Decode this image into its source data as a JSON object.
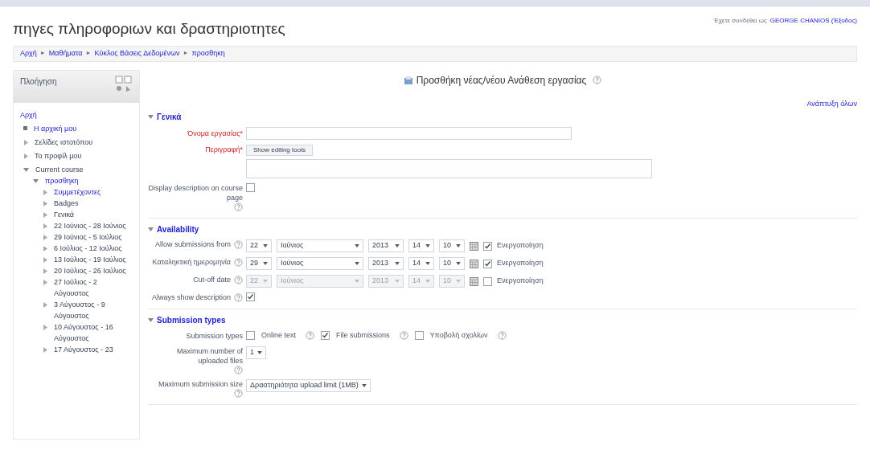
{
  "header": {
    "title": "πηγες πληροφοριων και δραστηριοτητες",
    "login_text": "Έχετε συνδεθεί ως",
    "login_link": "GEORGE CHANIOS (Έξοδος)"
  },
  "breadcrumb": [
    "Αρχή",
    "Μαθήματα",
    "Κύκλος Βάσεις Δεδομένων",
    "προσθηκη"
  ],
  "breadcrumb_separator": "►",
  "sidebar": {
    "title": "Πλοήγηση",
    "items": [
      {
        "label": "Αρχή",
        "kind": "root",
        "link": true
      },
      {
        "label": "Η αρχική μου",
        "kind": "leaf",
        "link": true
      },
      {
        "label": "Σελίδες ιστοτόπου",
        "kind": "branch",
        "link": false,
        "expanded": false
      },
      {
        "label": "Το προφίλ μου",
        "kind": "branch",
        "link": false,
        "expanded": false
      },
      {
        "label": "Current course",
        "kind": "branch",
        "link": false,
        "expanded": true,
        "children": [
          {
            "label": "προσθηκη",
            "kind": "branch",
            "link": true,
            "expanded": true,
            "children": [
              {
                "label": "Συμμετέχοντες",
                "kind": "branch",
                "link": true,
                "expanded": false
              },
              {
                "label": "Badges",
                "kind": "branch",
                "link": false,
                "expanded": false
              },
              {
                "label": "Γενικά",
                "kind": "branch",
                "link": false,
                "expanded": false
              },
              {
                "label": "22 Ιούνιος - 28 Ιούνιος",
                "kind": "branch",
                "link": false,
                "expanded": false
              },
              {
                "label": "29 Ιούνιος - 5 Ιούλιος",
                "kind": "branch",
                "link": false,
                "expanded": false
              },
              {
                "label": "6 Ιούλιος - 12 Ιούλιος",
                "kind": "branch",
                "link": false,
                "expanded": false
              },
              {
                "label": "13 Ιούλιος - 19 Ιούλιος",
                "kind": "branch",
                "link": false,
                "expanded": false
              },
              {
                "label": "20 Ιούλιος - 26 Ιούλιος",
                "kind": "branch",
                "link": false,
                "expanded": false
              },
              {
                "label": "27 Ιούλιος - 2 Αύγουστος",
                "kind": "branch",
                "link": false,
                "expanded": false
              },
              {
                "label": "3 Αύγουστος - 9 Αύγουστος",
                "kind": "branch",
                "link": false,
                "expanded": false
              },
              {
                "label": "10 Αύγουστος - 16 Αύγουστος",
                "kind": "branch",
                "link": false,
                "expanded": false
              },
              {
                "label": "17 Αύγουστος - 23",
                "kind": "branch",
                "link": false,
                "expanded": false
              }
            ]
          }
        ]
      }
    ]
  },
  "page_heading": "Προσθήκη νέας/νέου Ανάθεση εργασίας",
  "expand_all": "Ανάπτυξη όλων",
  "sections": [
    {
      "title": "Γενικά",
      "expanded": true,
      "rows": [
        {
          "kind": "text",
          "label": "Όνομα εργασίας*",
          "required": true,
          "help": false
        },
        {
          "kind": "editor",
          "label": "Περιγραφή*",
          "required": true,
          "help": false,
          "button": "Show editing tools"
        },
        {
          "kind": "checkbox",
          "label": "Display description on course page",
          "required": false,
          "help": true,
          "checked": false
        }
      ]
    },
    {
      "title": "Availability",
      "expanded": true,
      "rows": [
        {
          "kind": "date",
          "label": "Allow submissions from",
          "required": false,
          "help": true,
          "disabled": false,
          "checked": true,
          "enable_label": "Ενεργοποίηση",
          "fields": [
            "22",
            "Ιούνιος",
            "2013",
            "14",
            "10"
          ]
        },
        {
          "kind": "date",
          "label": "Καταληκτική ημερομηνία",
          "required": false,
          "help": true,
          "disabled": false,
          "checked": true,
          "enable_label": "Ενεργοποίηση",
          "fields": [
            "29",
            "Ιούνιος",
            "2013",
            "14",
            "10"
          ]
        },
        {
          "kind": "date",
          "label": "Cut-off date",
          "required": false,
          "help": true,
          "disabled": true,
          "checked": false,
          "enable_label": "Ενεργοποίηση",
          "fields": [
            "22",
            "Ιούνιος",
            "2013",
            "14",
            "10"
          ]
        },
        {
          "kind": "checkbox",
          "label": "Always show description",
          "required": false,
          "help": true,
          "checked": true
        }
      ]
    },
    {
      "title": "Submission types",
      "expanded": true,
      "rows": [
        {
          "kind": "options",
          "label": "Submission types",
          "required": false,
          "help": false,
          "options": [
            {
              "label": "Online text",
              "checked": false
            },
            {
              "label": "File submissions",
              "checked": true
            },
            {
              "label": "Υποβολή σχολίων",
              "checked": false
            }
          ]
        },
        {
          "kind": "select",
          "label": "Maximum number of uploaded files",
          "required": false,
          "help": true,
          "value": "1"
        },
        {
          "kind": "select",
          "label": "Maximum submission size",
          "required": false,
          "help": true,
          "value": "Δραστηριότητα upload limit (1MB)"
        }
      ]
    }
  ]
}
